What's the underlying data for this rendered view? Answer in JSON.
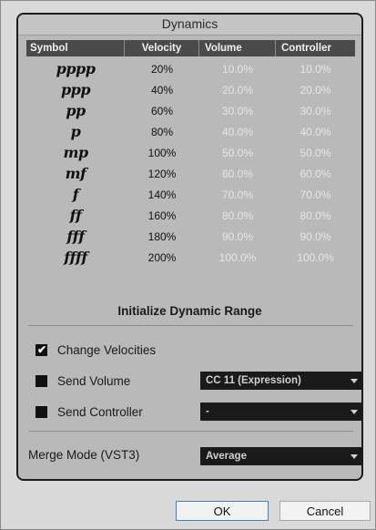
{
  "dialog": {
    "title": "Dynamics"
  },
  "table": {
    "headers": [
      "Symbol",
      "Velocity",
      "Volume",
      "Controller"
    ],
    "rows": [
      {
        "symbol": "pppp",
        "velocity": "20%",
        "volume": "10.0%",
        "controller": "10.0%"
      },
      {
        "symbol": "ppp",
        "velocity": "40%",
        "volume": "20.0%",
        "controller": "20.0%"
      },
      {
        "symbol": "pp",
        "velocity": "60%",
        "volume": "30.0%",
        "controller": "30.0%"
      },
      {
        "symbol": "p",
        "velocity": "80%",
        "volume": "40.0%",
        "controller": "40.0%"
      },
      {
        "symbol": "mp",
        "velocity": "100%",
        "volume": "50.0%",
        "controller": "50.0%"
      },
      {
        "symbol": "mf",
        "velocity": "120%",
        "volume": "60.0%",
        "controller": "60.0%"
      },
      {
        "symbol": "f",
        "velocity": "140%",
        "volume": "70.0%",
        "controller": "70.0%"
      },
      {
        "symbol": "ff",
        "velocity": "160%",
        "volume": "80.0%",
        "controller": "80.0%"
      },
      {
        "symbol": "fff",
        "velocity": "180%",
        "volume": "90.0%",
        "controller": "90.0%"
      },
      {
        "symbol": "ffff",
        "velocity": "200%",
        "volume": "100.0%",
        "controller": "100.0%"
      }
    ]
  },
  "init_range_label": "Initialize Dynamic Range",
  "options": {
    "change_velocities": {
      "label": "Change Velocities",
      "checked": true
    },
    "send_volume": {
      "label": "Send Volume",
      "checked": false,
      "dropdown_value": "CC 11 (Expression)"
    },
    "send_controller": {
      "label": "Send Controller",
      "checked": false,
      "dropdown_value": "-"
    }
  },
  "merge_mode": {
    "label": "Merge Mode (VST3)",
    "value": "Average"
  },
  "buttons": {
    "ok": "OK",
    "cancel": "Cancel"
  },
  "icons": {
    "checkmark": "checkmark-icon",
    "dropdown": "chevron-down-icon"
  },
  "colors": {
    "header_bg": "#4a4a4a",
    "panel_bg": "#b9b9b9",
    "dropdown_bg": "#1a1a1a",
    "ok_border": "#3c7fd6"
  }
}
